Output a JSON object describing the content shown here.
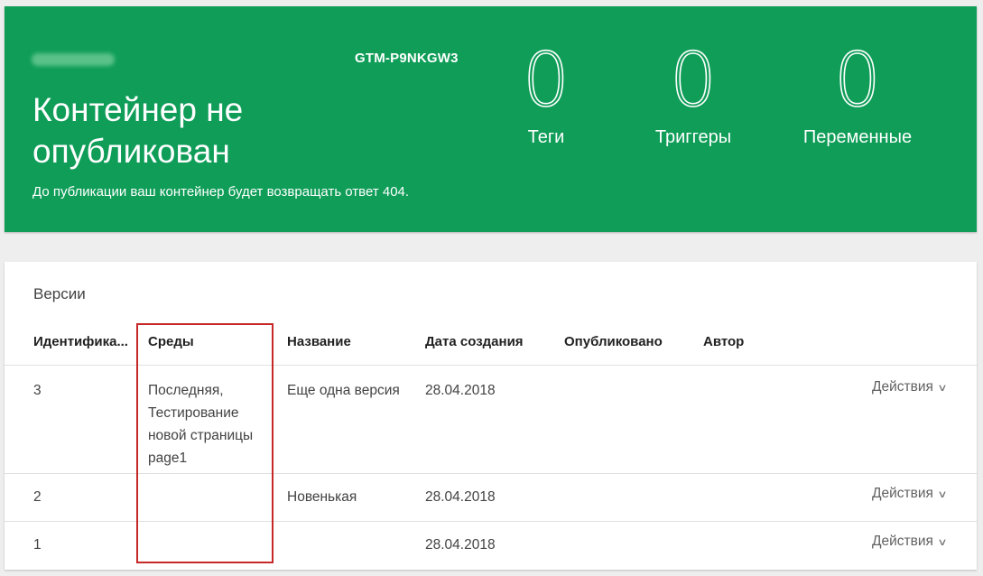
{
  "header": {
    "container_id": "GTM-P9NKGW3",
    "status_title": "Контейнер не опубликован",
    "status_description": "До публикации ваш контейнер будет возвращать ответ 404.",
    "stats": [
      {
        "value": "0",
        "label": "Теги"
      },
      {
        "value": "0",
        "label": "Триггеры"
      },
      {
        "value": "0",
        "label": "Переменные"
      }
    ],
    "accent_color": "#0f9d58"
  },
  "versions": {
    "title": "Версии",
    "columns": [
      "Идентифика...",
      "Среды",
      "Название",
      "Дата создания",
      "Опубликовано",
      "Автор"
    ],
    "rows": [
      {
        "id": "3",
        "environments": [
          "Последняя,",
          "Тестирование",
          "новой страницы",
          "page1"
        ],
        "name": "Еще одна версия",
        "created": "28.04.2018",
        "published": "",
        "author": "",
        "actions": "Действия"
      },
      {
        "id": "2",
        "environments": [],
        "name": "Новенькая",
        "created": "28.04.2018",
        "published": "",
        "author": "",
        "actions": "Действия"
      },
      {
        "id": "1",
        "environments": [],
        "name": "",
        "created": "28.04.2018",
        "published": "",
        "author": "",
        "actions": "Действия"
      }
    ],
    "highlight_color": "#c62828"
  }
}
